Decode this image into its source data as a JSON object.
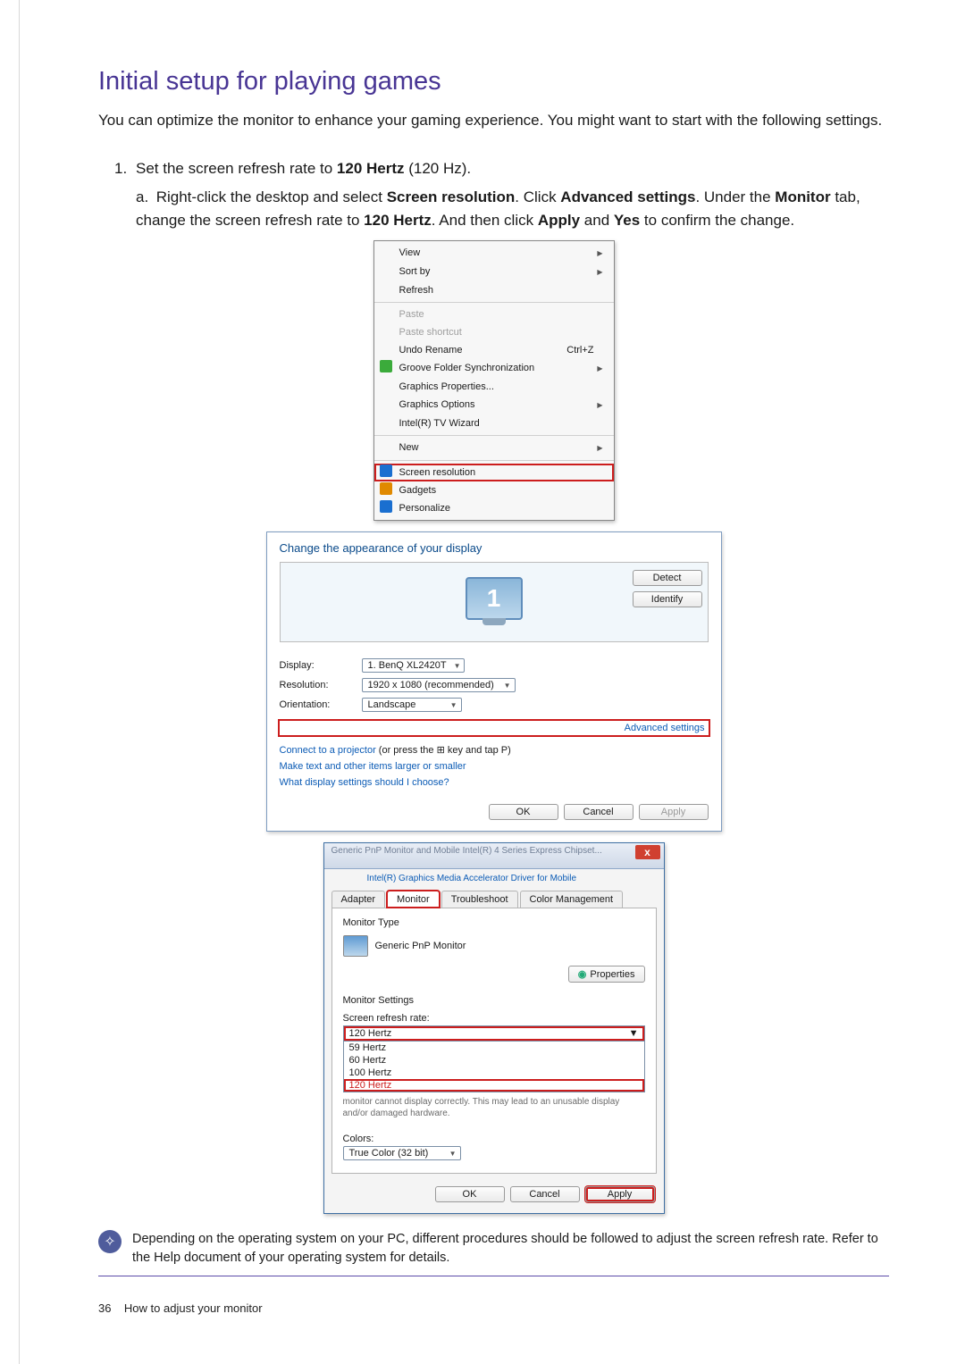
{
  "title": "Initial setup for playing games",
  "intro": "You can optimize the monitor to enhance your gaming experience. You might want to start with the following settings.",
  "step1": {
    "num": "1.",
    "pre": "Set the screen refresh rate to ",
    "bold": "120 Hertz",
    "post": " (120 Hz).",
    "sub_letter": "a.",
    "sub_seg1": " Right-click the desktop and select ",
    "sub_b1": "Screen resolution",
    "sub_seg2": ". Click ",
    "sub_b2": "Advanced settings",
    "sub_seg3": ". Under the ",
    "sub_b3": "Monitor",
    "sub_seg4": " tab, change the screen refresh rate to ",
    "sub_b4": "120 Hertz",
    "sub_seg5": ". And then click ",
    "sub_b5": "Apply",
    "sub_seg6": " and ",
    "sub_b6": "Yes",
    "sub_seg7": " to confirm the change."
  },
  "ctx": {
    "view": "View",
    "sortby": "Sort by",
    "refresh": "Refresh",
    "paste": "Paste",
    "paste_shortcut": "Paste shortcut",
    "undo_rename": "Undo Rename",
    "undo_key": "Ctrl+Z",
    "groove": "Groove Folder Synchronization",
    "gfx_props": "Graphics Properties...",
    "gfx_opts": "Graphics Options",
    "intel_tv": "Intel(R) TV Wizard",
    "new": "New",
    "screen_res": "Screen resolution",
    "gadgets": "Gadgets",
    "personalize": "Personalize"
  },
  "reswin": {
    "heading": "Change the appearance of your display",
    "detect": "Detect",
    "identify": "Identify",
    "display_lbl": "Display:",
    "display_val": "1. BenQ XL2420T",
    "resolution_lbl": "Resolution:",
    "resolution_val": "1920 x 1080 (recommended)",
    "orientation_lbl": "Orientation:",
    "orientation_val": "Landscape",
    "adv": "Advanced settings",
    "projector_pre": "Connect to a projector ",
    "projector_post": "(or press the ⊞ key and tap P)",
    "textsize": "Make text and other items larger or smaller",
    "whichsettings": "What display settings should I choose?",
    "ok": "OK",
    "cancel": "Cancel",
    "apply": "Apply",
    "monitor_num": "1"
  },
  "props": {
    "titlebar": "Generic PnP Monitor and Mobile Intel(R) 4 Series Express Chipset...",
    "extra_tab": "Intel(R) Graphics Media Accelerator Driver for Mobile",
    "tab_adapter": "Adapter",
    "tab_monitor": "Monitor",
    "tab_troubleshoot": "Troubleshoot",
    "tab_color": "Color Management",
    "mon_type_lbl": "Monitor Type",
    "mon_name": "Generic PnP Monitor",
    "properties_btn": "Properties",
    "mon_settings": "Monitor Settings",
    "rate_lbl": "Screen refresh rate:",
    "rate_sel": "120 Hertz",
    "rates": [
      "59 Hertz",
      "60 Hertz",
      "100 Hertz",
      "120 Hertz"
    ],
    "warn": "monitor cannot display correctly. This may lead to an unusable display and/or damaged hardware.",
    "colors_lbl": "Colors:",
    "colors_val": "True Color (32 bit)",
    "ok": "OK",
    "cancel": "Cancel",
    "apply": "Apply"
  },
  "tip": "Depending on the operating system on your PC, different procedures should be followed to adjust the screen refresh rate. Refer to the Help document of your operating system for details.",
  "footer_num": "36",
  "footer_text": "How to adjust your monitor"
}
